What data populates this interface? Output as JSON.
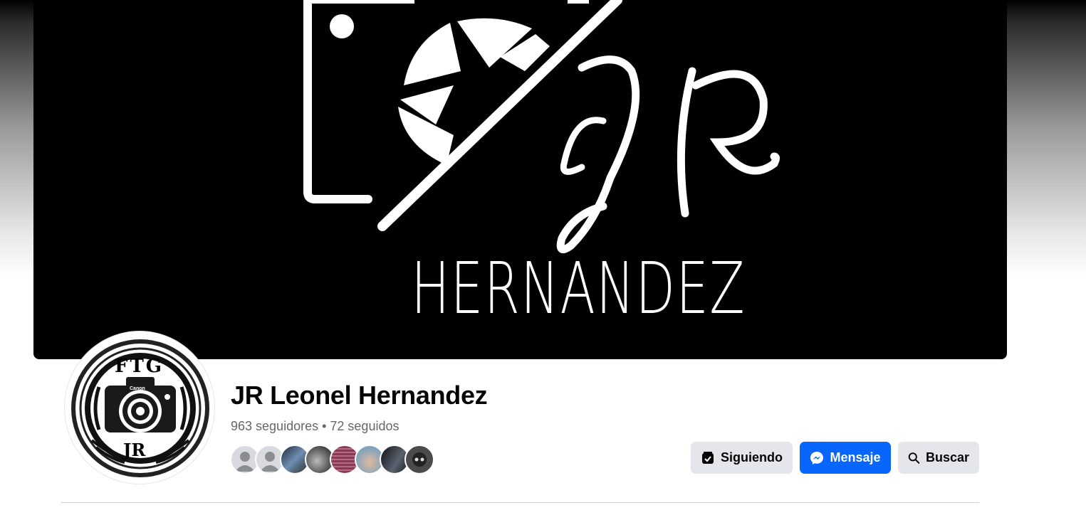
{
  "cover": {
    "logo_monogram": "JR",
    "logo_wordmark": "HERNANDEZ"
  },
  "avatar": {
    "top_text": "FTG",
    "bottom_text": "JR",
    "camera_brand": "Canon"
  },
  "profile": {
    "name": "JR Leonel Hernandez",
    "stats": "963 seguidores • 72 seguidos"
  },
  "friends_preview": [
    {
      "kind": "default-avatar",
      "color": "#d8dadf"
    },
    {
      "kind": "default-avatar",
      "color": "#d8dadf"
    },
    {
      "kind": "photo",
      "color": "#3f5a7a"
    },
    {
      "kind": "photo",
      "color": "#6b6b6b"
    },
    {
      "kind": "photo",
      "color": "#8a3a55"
    },
    {
      "kind": "photo",
      "color": "#9fb6c6"
    },
    {
      "kind": "photo",
      "color": "#2b3038"
    },
    {
      "kind": "photo",
      "color": "#4b4b4b"
    }
  ],
  "actions": {
    "following_label": "Siguiendo",
    "message_label": "Mensaje",
    "search_label": "Buscar"
  },
  "colors": {
    "brand_blue": "#0866ff",
    "secondary_button": "#e4e6eb",
    "muted_text": "#65676b"
  }
}
